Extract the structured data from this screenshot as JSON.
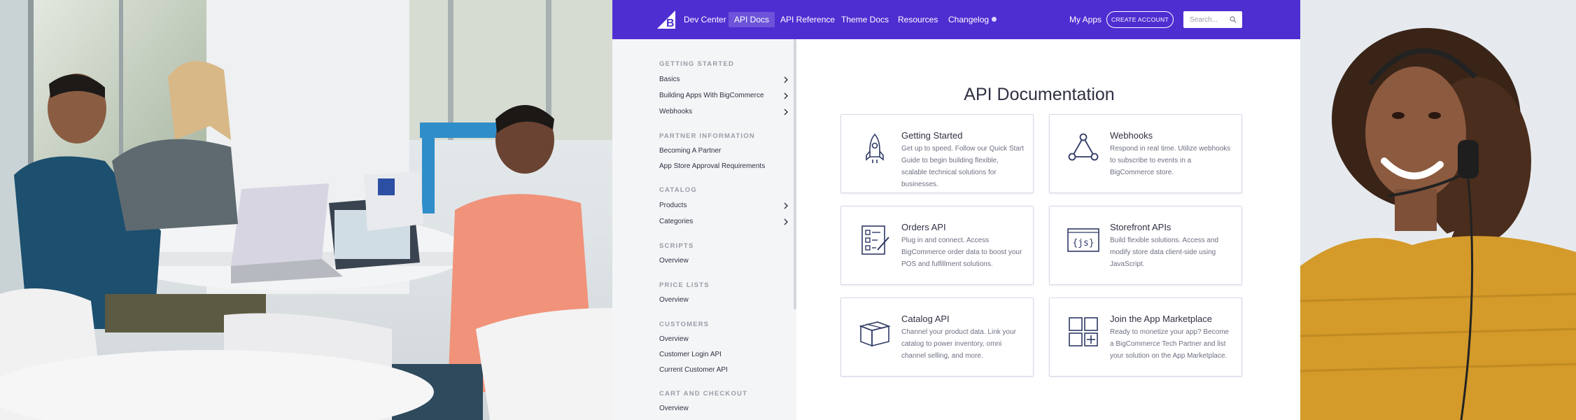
{
  "header": {
    "nav": [
      {
        "label": "Dev Center",
        "active": false
      },
      {
        "label": "API Docs",
        "active": true
      },
      {
        "label": "API Reference",
        "active": false
      },
      {
        "label": "Theme Docs",
        "active": false
      },
      {
        "label": "Resources",
        "active": false
      },
      {
        "label": "Changelog",
        "active": false
      }
    ],
    "my_apps": "My Apps",
    "create_account": "CREATE ACCOUNT",
    "search_placeholder": "Search...",
    "brand_color": "#4e2ed1"
  },
  "sidebar": {
    "sections": [
      {
        "title": "GETTING STARTED",
        "items": [
          {
            "label": "Basics",
            "expandable": true
          },
          {
            "label": "Building Apps With BigCommerce",
            "expandable": true
          },
          {
            "label": "Webhooks",
            "expandable": true
          }
        ]
      },
      {
        "title": "PARTNER INFORMATION",
        "items": [
          {
            "label": "Becoming A Partner",
            "expandable": false
          },
          {
            "label": "App Store Approval Requirements",
            "expandable": false
          }
        ]
      },
      {
        "title": "CATALOG",
        "items": [
          {
            "label": "Products",
            "expandable": true
          },
          {
            "label": "Categories",
            "expandable": true
          }
        ]
      },
      {
        "title": "SCRIPTS",
        "items": [
          {
            "label": "Overview",
            "expandable": false
          }
        ]
      },
      {
        "title": "PRICE LISTS",
        "items": [
          {
            "label": "Overview",
            "expandable": false
          }
        ]
      },
      {
        "title": "CUSTOMERS",
        "items": [
          {
            "label": "Overview",
            "expandable": false
          },
          {
            "label": "Customer Login API",
            "expandable": false
          },
          {
            "label": "Current Customer API",
            "expandable": false
          }
        ]
      },
      {
        "title": "CART AND CHECKOUT",
        "items": [
          {
            "label": "Overview",
            "expandable": false
          }
        ]
      }
    ]
  },
  "main": {
    "title": "API Documentation",
    "cards": [
      {
        "icon": "rocket-icon",
        "title": "Getting Started",
        "description": "Get up to speed. Follow our Quick Start Guide to begin building flexible, scalable technical solutions for businesses."
      },
      {
        "icon": "webhooks-triangle-icon",
        "title": "Webhooks",
        "description": "Respond in real time. Utilize webhooks to subscribe to events in a BigCommerce store."
      },
      {
        "icon": "orders-checklist-icon",
        "title": "Orders API",
        "description": "Plug in and connect. Access BigCommerce order data to boost your POS and fulfillment solutions."
      },
      {
        "icon": "js-braces-icon",
        "title": "Storefront APIs",
        "description": "Build flexible solutions. Access and modify store data client-side using JavaScript."
      },
      {
        "icon": "box-icon",
        "title": "Catalog API",
        "description": "Channel your product data. Link your catalog to power inventory, omni channel selling, and more."
      },
      {
        "icon": "app-grid-icon",
        "title": "Join the App Marketplace",
        "description": "Ready to monetize your app? Become a BigCommerce Tech Partner and list your solution on the App Marketplace."
      }
    ]
  }
}
